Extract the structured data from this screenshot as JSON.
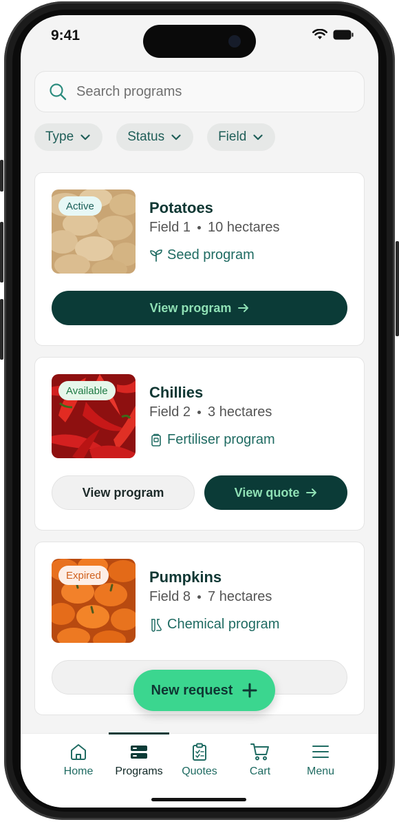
{
  "status_bar": {
    "time": "9:41"
  },
  "search": {
    "placeholder": "Search programs",
    "value": ""
  },
  "filters": [
    {
      "label": "Type"
    },
    {
      "label": "Status"
    },
    {
      "label": "Field"
    }
  ],
  "cards": [
    {
      "title": "Potatoes",
      "status": "Active",
      "field": "Field 1",
      "area": "10 hectares",
      "program": "Seed program",
      "program_icon": "seedling-icon",
      "primary_button": "View program"
    },
    {
      "title": "Chillies",
      "status": "Available",
      "field": "Field 2",
      "area": "3 hectares",
      "program": "Fertiliser program",
      "program_icon": "fertiliser-bag-icon",
      "secondary_button": "View program",
      "primary_button": "View quote"
    },
    {
      "title": "Pumpkins",
      "status": "Expired",
      "field": "Field 8",
      "area": "7 hectares",
      "program": "Chemical program",
      "program_icon": "flask-icon"
    }
  ],
  "fab": {
    "label": "New request"
  },
  "tabs": [
    {
      "label": "Home",
      "icon": "home-icon"
    },
    {
      "label": "Programs",
      "icon": "programs-icon",
      "active": true
    },
    {
      "label": "Quotes",
      "icon": "clipboard-icon"
    },
    {
      "label": "Cart",
      "icon": "cart-icon"
    },
    {
      "label": "Menu",
      "icon": "menu-icon"
    }
  ],
  "colors": {
    "brand_dark": "#0b3b37",
    "accent_green": "#3bd68f",
    "text_teal": "#1f6b62",
    "badge_active_bg": "#e7f8f6",
    "badge_available_bg": "#e6f7ea",
    "badge_expired_bg": "#fdeee6"
  }
}
